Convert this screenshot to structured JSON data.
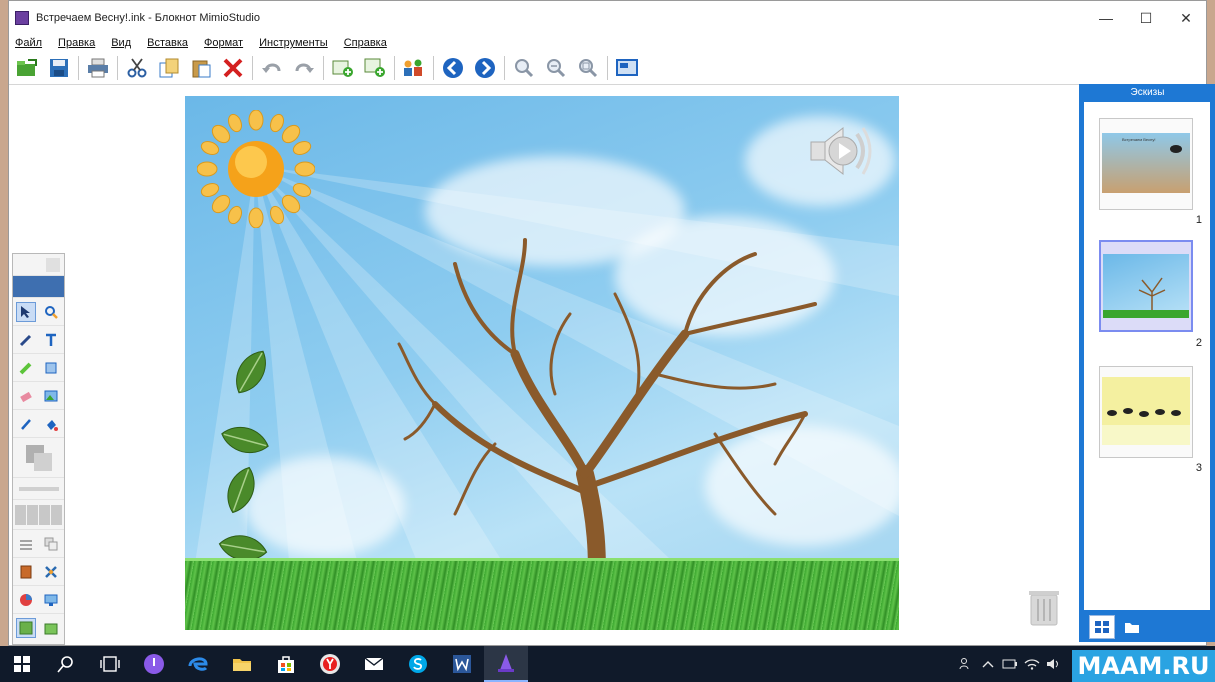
{
  "window": {
    "title": "Встречаем Весну!.ink - Блокнот MimioStudio",
    "controls": [
      "—",
      "☐",
      "✕"
    ]
  },
  "menu": [
    "Файл",
    "Правка",
    "Вид",
    "Вставка",
    "Формат",
    "Инструменты",
    "Справка"
  ],
  "toolbar_icons": [
    "open-icon",
    "save-icon",
    "print-icon",
    "cut-icon",
    "copy-icon",
    "paste-icon",
    "delete-icon",
    "undo-icon",
    "redo-icon",
    "add-page-icon",
    "add-page-below-icon",
    "collaborate-icon",
    "back-icon",
    "forward-icon",
    "zoom-in-icon",
    "zoom-out-icon",
    "zoom-fit-icon",
    "screen-icon"
  ],
  "sketches_panel": {
    "title": "Эскизы",
    "thumbnails": [
      {
        "number": "1",
        "caption": "Встречаем Весну!"
      },
      {
        "number": "2",
        "caption": ""
      },
      {
        "number": "3",
        "caption": ""
      }
    ],
    "selected_index": 1
  },
  "colors": {
    "accent": "#1e78d4",
    "sky": "#8fcdf0",
    "grass": "#3aa62e",
    "taskbar": "#101a2a"
  },
  "watermark": "MAAM.RU"
}
